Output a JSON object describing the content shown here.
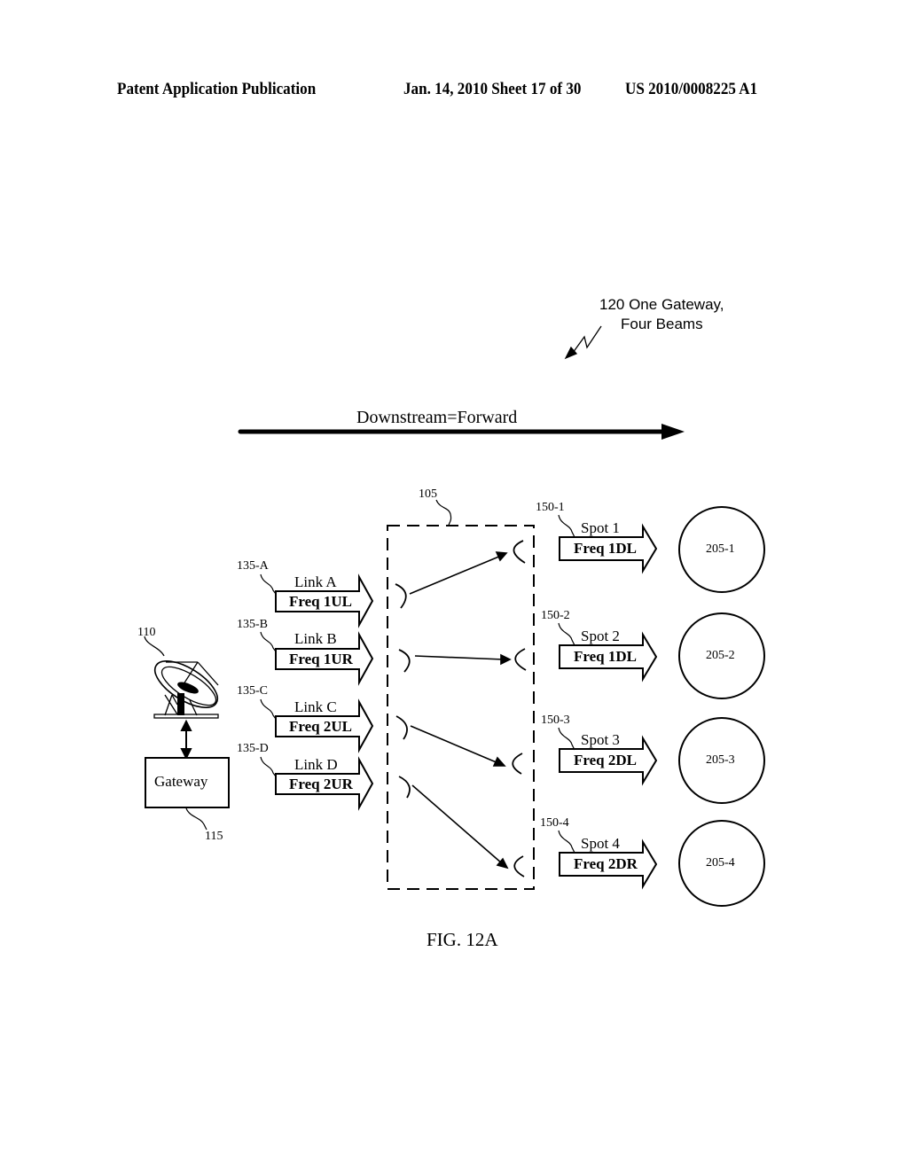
{
  "header": {
    "publication": "Patent Application Publication",
    "date_sheet": "Jan. 14, 2010  Sheet 17 of 30",
    "number": "US 2010/0008225 A1"
  },
  "title_callout": {
    "line1": "120 One Gateway,",
    "line2": "Four Beams"
  },
  "direction": {
    "label": "Downstream=Forward"
  },
  "satellite_ref": "105",
  "antenna": {
    "ref": "110"
  },
  "gateway": {
    "label": "Gateway",
    "ref": "115"
  },
  "uplinks": [
    {
      "ref": "135-A",
      "name": "Link A",
      "freq": "Freq 1UL"
    },
    {
      "ref": "135-B",
      "name": "Link B",
      "freq": "Freq 1UR"
    },
    {
      "ref": "135-C",
      "name": "Link C",
      "freq": "Freq 2UL"
    },
    {
      "ref": "135-D",
      "name": "Link D",
      "freq": "Freq 2UR"
    }
  ],
  "downlinks": [
    {
      "ref": "150-1",
      "name": "Spot 1",
      "freq": "Freq 1DL",
      "beam": "205-1"
    },
    {
      "ref": "150-2",
      "name": "Spot 2",
      "freq": "Freq 1DL",
      "beam": "205-2"
    },
    {
      "ref": "150-3",
      "name": "Spot 3",
      "freq": "Freq 2DL",
      "beam": "205-3"
    },
    {
      "ref": "150-4",
      "name": "Spot 4",
      "freq": "Freq 2DR",
      "beam": "205-4"
    }
  ],
  "figure_label": "FIG. 12A"
}
